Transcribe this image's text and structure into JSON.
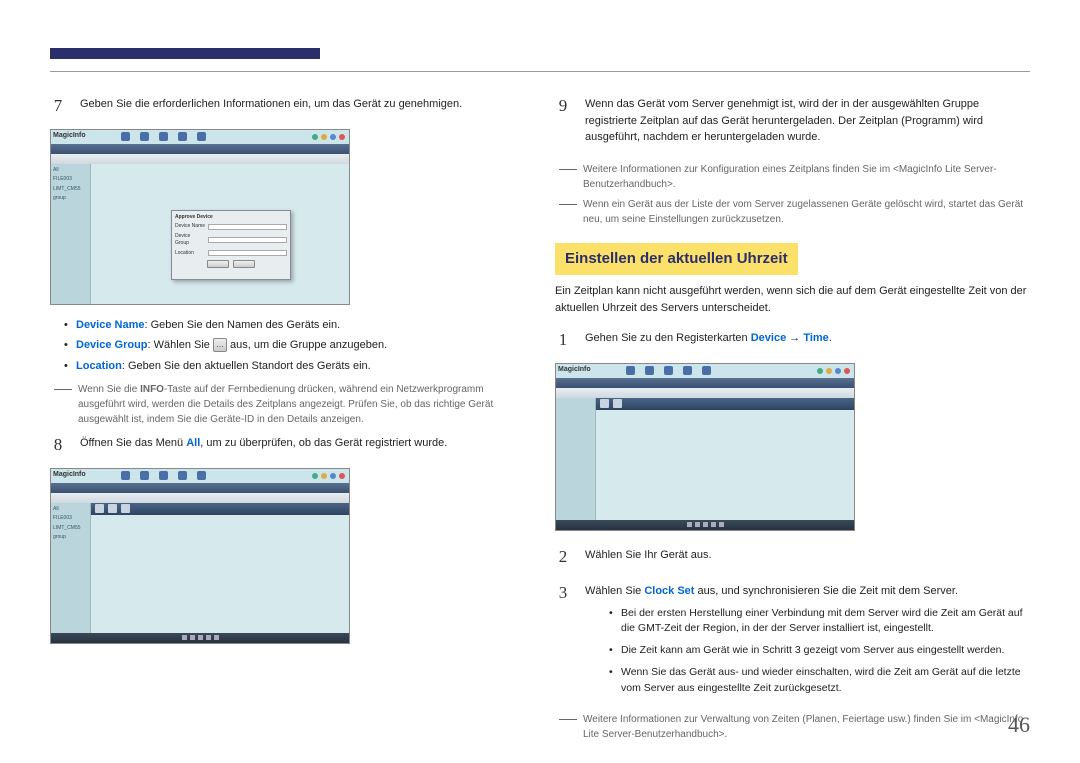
{
  "pageNumber": "46",
  "left": {
    "step7": {
      "num": "7",
      "text": "Geben Sie die erforderlichen Informationen ein, um das Gerät zu genehmigen.",
      "bullets": {
        "deviceName": {
          "label": "Device Name",
          "text": ": Geben Sie den Namen des Geräts ein."
        },
        "deviceGroup": {
          "label": "Device Group",
          "textBefore": ": Wählen Sie ",
          "textAfter": " aus, um die Gruppe anzugeben."
        },
        "location": {
          "label": "Location",
          "text": ": Geben Sie den aktuellen Standort des Geräts ein."
        }
      },
      "note": {
        "textBefore": "Wenn Sie die ",
        "info": "INFO",
        "textAfter": "-Taste auf der Fernbedienung drücken, während ein Netzwerkprogramm ausgeführt wird, werden die Details des Zeitplans angezeigt. Prüfen Sie, ob das richtige Gerät ausgewählt ist, indem Sie die Geräte-ID in den Details anzeigen."
      }
    },
    "step8": {
      "num": "8",
      "textBefore": "Öffnen Sie das Menü ",
      "all": "All",
      "textAfter": ", um zu überprüfen, ob das Gerät registriert wurde."
    }
  },
  "right": {
    "step9": {
      "num": "9",
      "text": "Wenn das Gerät vom Server genehmigt ist, wird der in der ausgewählten Gruppe registrierte Zeitplan auf das Gerät heruntergeladen. Der Zeitplan (Programm) wird ausgeführt, nachdem er heruntergeladen wurde."
    },
    "note1": "Weitere Informationen zur Konfiguration eines Zeitplans finden Sie im <MagicInfo Lite Server-Benutzerhandbuch>.",
    "note2": "Wenn ein Gerät aus der Liste der vom Server zugelassenen Geräte gelöscht wird, startet das Gerät neu, um seine Einstellungen zurückzusetzen.",
    "heading": "Einstellen der aktuellen Uhrzeit",
    "intro": "Ein Zeitplan kann nicht ausgeführt werden, wenn sich die auf dem Gerät eingestellte Zeit von der aktuellen Uhrzeit des Servers unterscheidet.",
    "stepT1": {
      "num": "1",
      "textBefore": "Gehen Sie zu den Registerkarten ",
      "device": "Device",
      "arrow": " → ",
      "time": "Time",
      "textAfter": "."
    },
    "stepT2": {
      "num": "2",
      "text": "Wählen Sie Ihr Gerät aus."
    },
    "stepT3": {
      "num": "3",
      "textBefore": "Wählen Sie ",
      "clockSet": "Clock Set",
      "textAfter": " aus, und synchronisieren Sie die Zeit mit dem Server.",
      "bullets": {
        "b1": "Bei der ersten Herstellung einer Verbindung mit dem Server wird die Zeit am Gerät auf die GMT-Zeit der Region, in der der Server installiert ist, eingestellt.",
        "b2": "Die Zeit kann am Gerät wie in Schritt 3 gezeigt vom Server aus eingestellt werden.",
        "b3": "Wenn Sie das Gerät aus- und wieder einschalten, wird die Zeit am Gerät auf die letzte vom Server aus eingestellte Zeit zurückgesetzt."
      }
    },
    "note3": "Weitere Informationen zur Verwaltung von Zeiten (Planen, Feiertage usw.) finden Sie im <MagicInfo Lite Server-Benutzerhandbuch>.",
    "logo": "MagicInfo",
    "sidebarItems": [
      "All",
      "FILE003",
      "LIMT_CM55",
      "group"
    ],
    "modal": {
      "title": "Approve Device",
      "deviceName": "Device Name",
      "deviceGroup": "Device Group",
      "location": "Location",
      "ok": "OK",
      "cancel": "Cancel"
    }
  }
}
